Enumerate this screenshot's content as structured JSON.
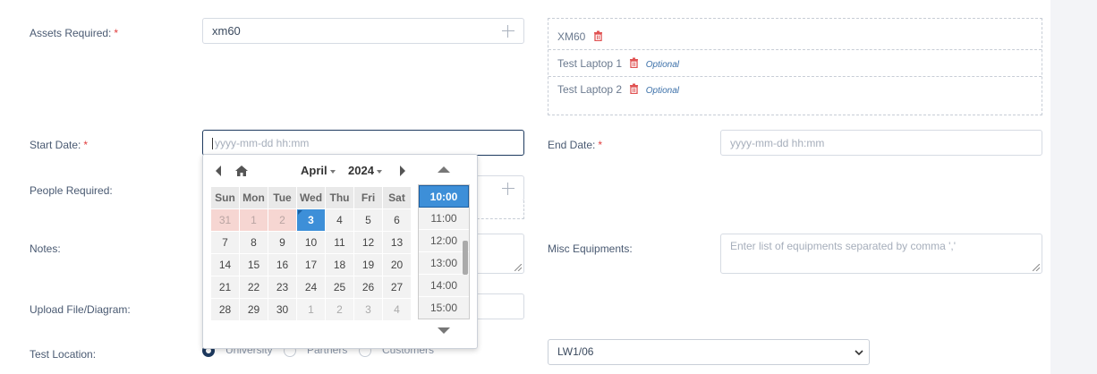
{
  "form": {
    "assets_label": "Assets Required:",
    "assets_value": "xm60",
    "assets_list": [
      {
        "name": "XM60",
        "optional": ""
      },
      {
        "name": "Test Laptop 1",
        "optional": "Optional"
      },
      {
        "name": "Test Laptop 2",
        "optional": "Optional"
      }
    ],
    "start_label": "Start Date:",
    "start_placeholder": "yyyy-mm-dd hh:mm",
    "end_label": "End Date:",
    "end_placeholder": "yyyy-mm-dd hh:mm",
    "people_label": "People Required:",
    "notes_label": "Notes:",
    "misc_label": "Misc Equipments:",
    "misc_placeholder": "Enter list of equipments separated by comma ','",
    "upload_label": "Upload File/Diagram:",
    "location_label": "Test Location:",
    "location_options": [
      "University",
      "Partners",
      "Customers"
    ],
    "location_selected": "University",
    "room_value": "LW1/06",
    "required_mark": "*"
  },
  "datepicker": {
    "month": "April",
    "year": "2024",
    "weekdays": [
      "Sun",
      "Mon",
      "Tue",
      "Wed",
      "Thu",
      "Fri",
      "Sat"
    ],
    "weeks": [
      [
        "31",
        "1",
        "2",
        "3",
        "4",
        "5",
        "6"
      ],
      [
        "7",
        "8",
        "9",
        "10",
        "11",
        "12",
        "13"
      ],
      [
        "14",
        "15",
        "16",
        "17",
        "18",
        "19",
        "20"
      ],
      [
        "21",
        "22",
        "23",
        "24",
        "25",
        "26",
        "27"
      ],
      [
        "28",
        "29",
        "30",
        "1",
        "2",
        "3",
        "4"
      ]
    ],
    "selected_day": "3",
    "times": [
      "10:00",
      "11:00",
      "12:00",
      "13:00",
      "14:00",
      "15:00"
    ],
    "selected_time": "10:00"
  },
  "colors": {
    "accent": "#3d8fd8",
    "required": "#e03d3d",
    "optional": "#3a6fa8",
    "trash": "#e05252"
  }
}
